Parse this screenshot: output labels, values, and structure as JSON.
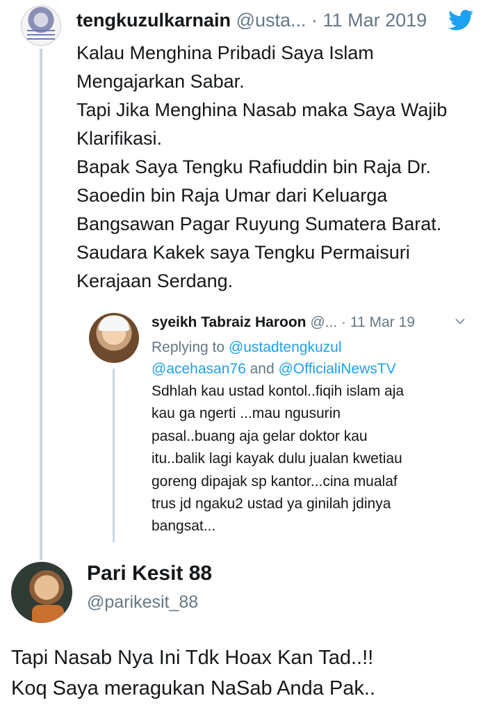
{
  "tweet": {
    "display_name": "tengkuzulkarnain",
    "handle": "@usta...",
    "separator": "·",
    "date": "11 Mar 2019",
    "icon": "twitter-bird-icon",
    "brand_color": "#1da1f2",
    "lines": [
      "Kalau Menghina Pribadi Saya Islam",
      "Mengajarkan Sabar.",
      "Tapi Jika Menghina Nasab maka Saya Wajib",
      "Klarifikasi.",
      "Bapak Saya Tengku Rafiuddin bin Raja Dr.",
      "Saoedin bin Raja Umar dari Keluarga",
      "Bangsawan Pagar Ruyung Sumatera Barat.",
      "Saudara Kakek saya Tengku Permaisuri",
      "Kerajaan Serdang."
    ]
  },
  "reply": {
    "display_name": "syeikh Tabraiz Haroon",
    "handle": "@...",
    "separator": "·",
    "date": "11 Mar 19",
    "chevron_icon": "chevron-down-icon",
    "replying_prefix": "Replying to ",
    "mention1": "@ustadtengkuzul",
    "mention2": "@acehasan76",
    "and": " and ",
    "mention3": "@OfficialiNewsTV",
    "lines": [
      "Sdhlah kau ustad kontol..fiqih islam aja",
      "kau ga ngerti ...mau ngusurin",
      "pasal..buang aja gelar doktor kau",
      "itu..balik lagi kayak dulu jualan kwetiau",
      "goreng dipajak sp kantor...cina mualaf",
      "trus jd ngaku2 ustad ya ginilah jdinya",
      "bangsat..."
    ]
  },
  "post": {
    "display_name": "Pari Kesit 88",
    "handle": "@parikesit_88",
    "lines": [
      "Tapi Nasab Nya Ini Tdk Hoax Kan Tad..!!",
      "Koq Saya meragukan NaSab Anda Pak.."
    ]
  }
}
